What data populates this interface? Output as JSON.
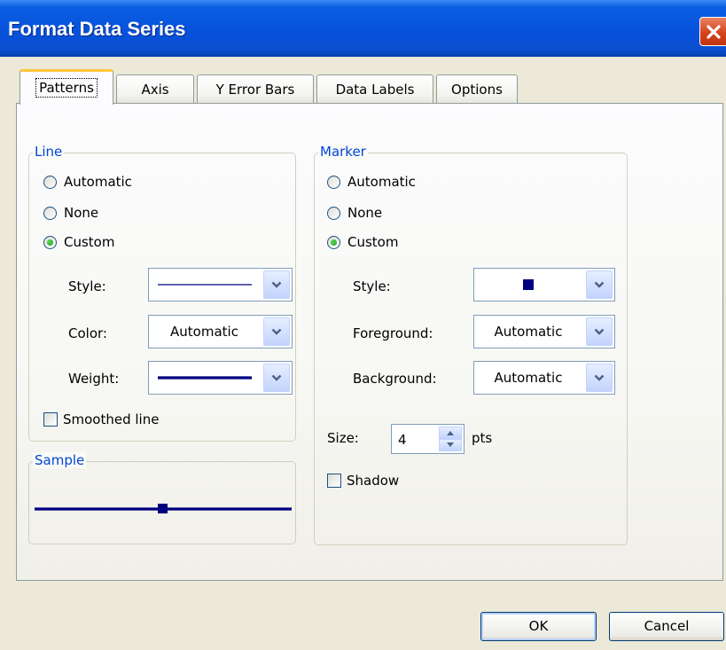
{
  "window": {
    "title": "Format Data Series"
  },
  "tabs": [
    {
      "label": "Patterns",
      "selected": true
    },
    {
      "label": "Axis",
      "selected": false
    },
    {
      "label": "Y Error Bars",
      "selected": false
    },
    {
      "label": "Data Labels",
      "selected": false
    },
    {
      "label": "Options",
      "selected": false
    }
  ],
  "line_group": {
    "label": "Line",
    "options": {
      "automatic": "Automatic",
      "none": "None",
      "custom": "Custom"
    },
    "selected": "Custom",
    "style_label": "Style:",
    "color_label": "Color:",
    "color_value": "Automatic",
    "weight_label": "Weight:",
    "smoothed_label": "Smoothed line",
    "smoothed_checked": false
  },
  "sample_group": {
    "label": "Sample"
  },
  "marker_group": {
    "label": "Marker",
    "options": {
      "automatic": "Automatic",
      "none": "None",
      "custom": "Custom"
    },
    "selected": "Custom",
    "style_label": "Style:",
    "foreground_label": "Foreground:",
    "foreground_value": "Automatic",
    "background_label": "Background:",
    "background_value": "Automatic",
    "size_label": "Size:",
    "size_value": "4",
    "size_unit": "pts",
    "shadow_label": "Shadow",
    "shadow_checked": false
  },
  "buttons": {
    "ok": "OK",
    "cancel": "Cancel"
  },
  "colors": {
    "title_bar": "#0a5fe0",
    "accent": "#0046d5",
    "line_color": "#000080",
    "tab_highlight": "#ffc73c"
  },
  "icons": {
    "close": "close-icon",
    "dropdown": "chevron-down-icon",
    "spin_up": "spin-up-icon",
    "spin_down": "spin-down-icon"
  }
}
